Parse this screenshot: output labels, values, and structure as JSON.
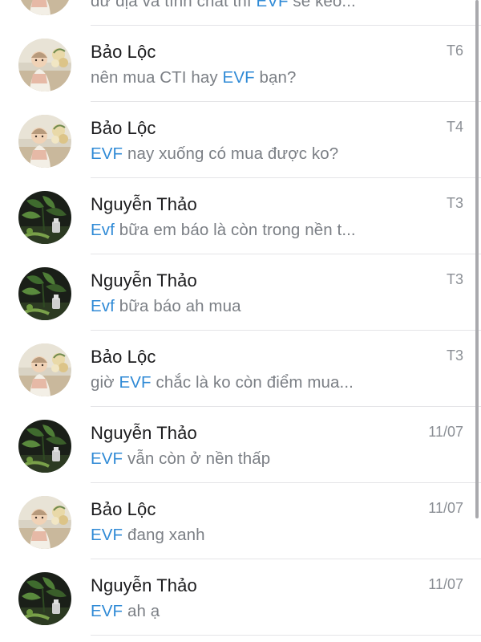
{
  "conversations": [
    {
      "avatar": "baby-photo-avatar",
      "name": "",
      "date": "",
      "preview_parts": [
        {
          "text": "dư địa và tính chất thì ",
          "hl": false
        },
        {
          "text": "EVF",
          "hl": true
        },
        {
          "text": " sẽ kéo...",
          "hl": false
        }
      ]
    },
    {
      "avatar": "baby-photo-avatar",
      "name": "Bảo Lộc",
      "date": "T6",
      "preview_parts": [
        {
          "text": "nên mua CTI hay ",
          "hl": false
        },
        {
          "text": "EVF",
          "hl": true
        },
        {
          "text": " bạn?",
          "hl": false
        }
      ]
    },
    {
      "avatar": "baby-photo-avatar",
      "name": "Bảo Lộc",
      "date": "T4",
      "preview_parts": [
        {
          "text": "EVF",
          "hl": true
        },
        {
          "text": " nay xuống có mua được ko?",
          "hl": false
        }
      ]
    },
    {
      "avatar": "plant-photo-avatar",
      "name": "Nguyễn Thảo",
      "date": "T3",
      "preview_parts": [
        {
          "text": "Evf",
          "hl": true
        },
        {
          "text": " bữa em báo là còn trong nền t...",
          "hl": false
        }
      ]
    },
    {
      "avatar": "plant-photo-avatar",
      "name": "Nguyễn Thảo",
      "date": "T3",
      "preview_parts": [
        {
          "text": "Evf",
          "hl": true
        },
        {
          "text": " bữa báo ah mua",
          "hl": false
        }
      ]
    },
    {
      "avatar": "baby-photo-avatar",
      "name": "Bảo Lộc",
      "date": "T3",
      "preview_parts": [
        {
          "text": "giờ ",
          "hl": false
        },
        {
          "text": "EVF",
          "hl": true
        },
        {
          "text": " chắc là ko còn điểm mua...",
          "hl": false
        }
      ]
    },
    {
      "avatar": "plant-photo-avatar",
      "name": "Nguyễn Thảo",
      "date": "11/07",
      "preview_parts": [
        {
          "text": "EVF",
          "hl": true
        },
        {
          "text": " vẫn còn ở nền thấp",
          "hl": false
        }
      ]
    },
    {
      "avatar": "baby-photo-avatar",
      "name": "Bảo Lộc",
      "date": "11/07",
      "preview_parts": [
        {
          "text": "EVF",
          "hl": true
        },
        {
          "text": " đang xanh",
          "hl": false
        }
      ]
    },
    {
      "avatar": "plant-photo-avatar",
      "name": "Nguyễn Thảo",
      "date": "11/07",
      "preview_parts": [
        {
          "text": "EVF",
          "hl": true
        },
        {
          "text": " ah ạ",
          "hl": false
        }
      ]
    }
  ],
  "colors": {
    "highlight": "#2f8ad6",
    "name_text": "#1c1c1e",
    "preview_text": "#7b7f85",
    "date_text": "#8a8e94",
    "separator": "#e4e4e7"
  }
}
